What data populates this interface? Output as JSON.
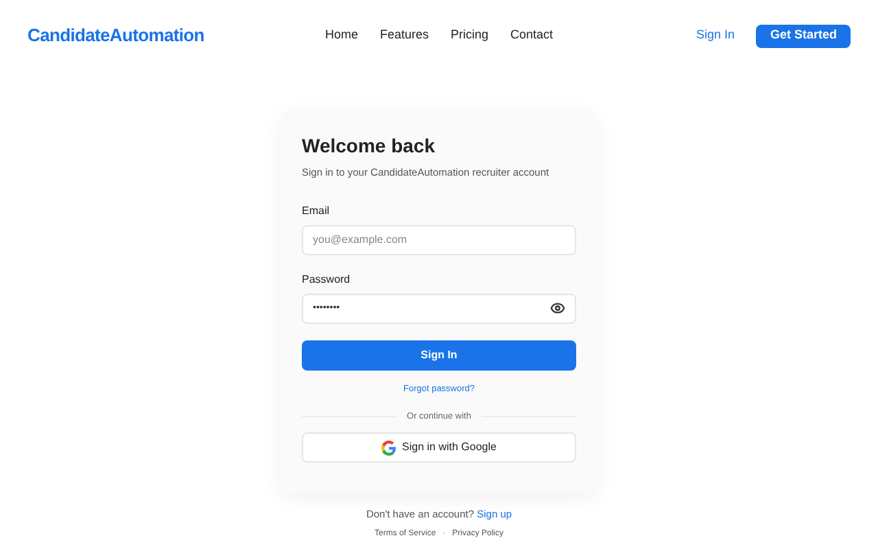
{
  "header": {
    "logo": "CandidateAutomation",
    "nav": [
      "Home",
      "Features",
      "Pricing",
      "Contact"
    ],
    "sign_in": "Sign In",
    "get_started": "Get Started"
  },
  "card": {
    "title": "Welcome back",
    "subtitle": "Sign in to your CandidateAutomation recruiter account",
    "email": {
      "label": "Email",
      "placeholder": "you@example.com"
    },
    "password": {
      "label": "Password",
      "value": "••••••••"
    },
    "submit": "Sign In",
    "forgot": "Forgot password?",
    "divider": "Or continue with",
    "google": "Sign in with Google"
  },
  "footer": {
    "prompt": "Don't have an account?",
    "signup": "Sign up",
    "links": [
      "Terms of Service",
      "Privacy Policy"
    ],
    "separator": "·"
  }
}
